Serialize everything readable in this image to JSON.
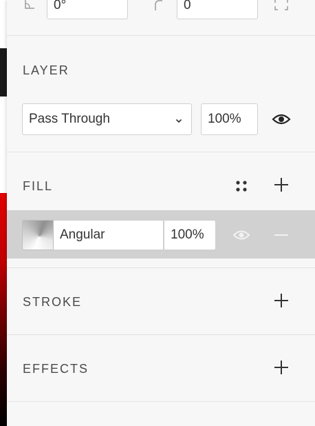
{
  "top": {
    "rotation_value": "0°",
    "corner_value": "0"
  },
  "layer": {
    "title": "LAYER",
    "blend_mode": "Pass Through",
    "opacity": "100%"
  },
  "fill": {
    "title": "FILL",
    "items": [
      {
        "type": "Angular",
        "opacity": "100%"
      }
    ]
  },
  "stroke": {
    "title": "STROKE"
  },
  "effects": {
    "title": "EFFECTS"
  },
  "icons": [
    "rotation-icon",
    "corner-radius-icon",
    "expand-corners-icon",
    "eye-icon",
    "styles-grid-icon",
    "plus-icon",
    "minus-icon",
    "chevron-down-icon"
  ]
}
